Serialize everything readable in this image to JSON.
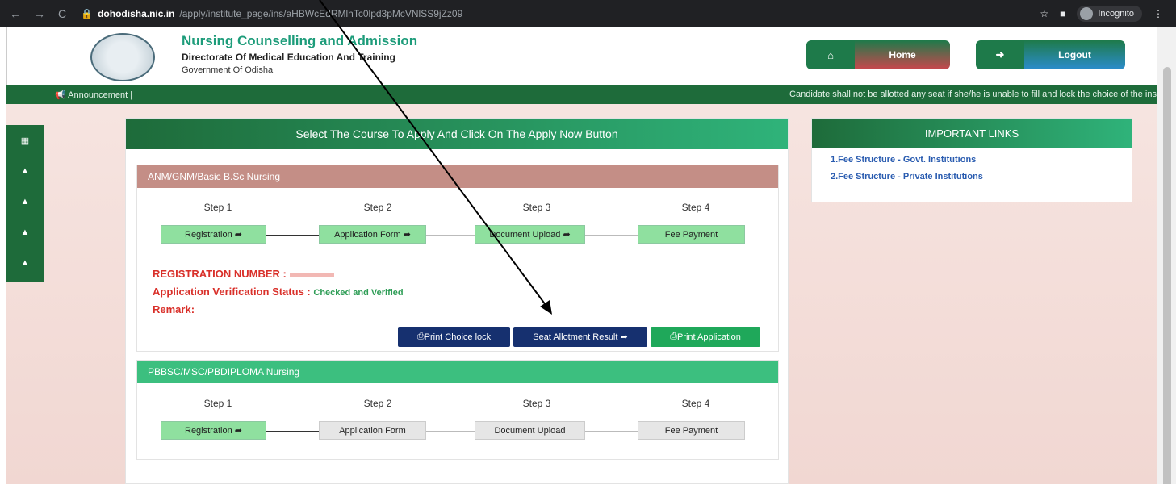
{
  "browser": {
    "url_host": "dohodisha.nic.in",
    "url_path": "/apply/institute_page/ins/aHBWcEdRMlhTc0lpd3pMcVNlSS9jZz09",
    "incognito_label": "Incognito"
  },
  "header": {
    "title": "Nursing Counselling and Admission",
    "subtitle": "Directorate Of Medical Education And Training",
    "org": "Government Of Odisha",
    "home_label": "Home",
    "logout_label": "Logout"
  },
  "announcement": {
    "label": "Announcement |",
    "text": "Candidate shall not be allotted any seat if she/he is unable to fill and lock the choice of the ins"
  },
  "main": {
    "title": "Select The Course To Apply And Click On The Apply Now Button",
    "course1": {
      "name": "ANM/GNM/Basic B.Sc Nursing",
      "step_labels": [
        "Step 1",
        "Step 2",
        "Step 3",
        "Step 4"
      ],
      "steps": [
        "Registration",
        "Application Form",
        "Document Upload",
        "Fee Payment"
      ],
      "reg_label": "REGISTRATION NUMBER :",
      "status_label": "Application Verification Status :",
      "status_value": "Checked and Verified",
      "remark_label": "Remark:",
      "btn_print_choice": "Print Choice lock",
      "btn_seat_result": "Seat Allotment Result",
      "btn_print_app": "Print Application"
    },
    "course2": {
      "name": "PBBSC/MSC/PBDIPLOMA Nursing",
      "step_labels": [
        "Step 1",
        "Step 2",
        "Step 3",
        "Step 4"
      ],
      "steps": [
        "Registration",
        "Application Form",
        "Document Upload",
        "Fee Payment"
      ]
    }
  },
  "links": {
    "title": "IMPORTANT LINKS",
    "items": [
      "1.Fee Structure - Govt. Institutions",
      "2.Fee Structure - Private Institutions"
    ]
  },
  "colors": {
    "brand_green": "#1e6b3a",
    "course1_header": "#c48e86",
    "course2_header": "#3cbf7f",
    "status_red": "#d9302a"
  }
}
